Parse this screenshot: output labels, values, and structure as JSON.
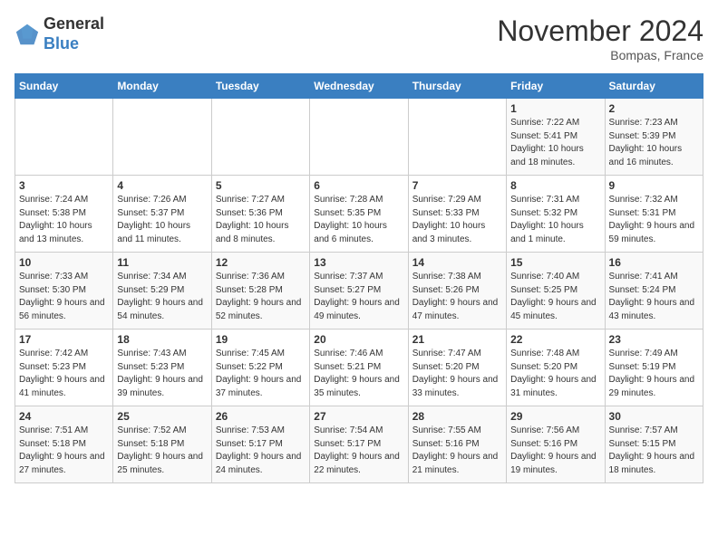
{
  "logo": {
    "general": "General",
    "blue": "Blue"
  },
  "title": "November 2024",
  "location": "Bompas, France",
  "days_of_week": [
    "Sunday",
    "Monday",
    "Tuesday",
    "Wednesday",
    "Thursday",
    "Friday",
    "Saturday"
  ],
  "weeks": [
    [
      {
        "day": "",
        "sunrise": "",
        "sunset": "",
        "daylight": ""
      },
      {
        "day": "",
        "sunrise": "",
        "sunset": "",
        "daylight": ""
      },
      {
        "day": "",
        "sunrise": "",
        "sunset": "",
        "daylight": ""
      },
      {
        "day": "",
        "sunrise": "",
        "sunset": "",
        "daylight": ""
      },
      {
        "day": "",
        "sunrise": "",
        "sunset": "",
        "daylight": ""
      },
      {
        "day": "1",
        "sunrise": "Sunrise: 7:22 AM",
        "sunset": "Sunset: 5:41 PM",
        "daylight": "Daylight: 10 hours and 18 minutes."
      },
      {
        "day": "2",
        "sunrise": "Sunrise: 7:23 AM",
        "sunset": "Sunset: 5:39 PM",
        "daylight": "Daylight: 10 hours and 16 minutes."
      }
    ],
    [
      {
        "day": "3",
        "sunrise": "Sunrise: 7:24 AM",
        "sunset": "Sunset: 5:38 PM",
        "daylight": "Daylight: 10 hours and 13 minutes."
      },
      {
        "day": "4",
        "sunrise": "Sunrise: 7:26 AM",
        "sunset": "Sunset: 5:37 PM",
        "daylight": "Daylight: 10 hours and 11 minutes."
      },
      {
        "day": "5",
        "sunrise": "Sunrise: 7:27 AM",
        "sunset": "Sunset: 5:36 PM",
        "daylight": "Daylight: 10 hours and 8 minutes."
      },
      {
        "day": "6",
        "sunrise": "Sunrise: 7:28 AM",
        "sunset": "Sunset: 5:35 PM",
        "daylight": "Daylight: 10 hours and 6 minutes."
      },
      {
        "day": "7",
        "sunrise": "Sunrise: 7:29 AM",
        "sunset": "Sunset: 5:33 PM",
        "daylight": "Daylight: 10 hours and 3 minutes."
      },
      {
        "day": "8",
        "sunrise": "Sunrise: 7:31 AM",
        "sunset": "Sunset: 5:32 PM",
        "daylight": "Daylight: 10 hours and 1 minute."
      },
      {
        "day": "9",
        "sunrise": "Sunrise: 7:32 AM",
        "sunset": "Sunset: 5:31 PM",
        "daylight": "Daylight: 9 hours and 59 minutes."
      }
    ],
    [
      {
        "day": "10",
        "sunrise": "Sunrise: 7:33 AM",
        "sunset": "Sunset: 5:30 PM",
        "daylight": "Daylight: 9 hours and 56 minutes."
      },
      {
        "day": "11",
        "sunrise": "Sunrise: 7:34 AM",
        "sunset": "Sunset: 5:29 PM",
        "daylight": "Daylight: 9 hours and 54 minutes."
      },
      {
        "day": "12",
        "sunrise": "Sunrise: 7:36 AM",
        "sunset": "Sunset: 5:28 PM",
        "daylight": "Daylight: 9 hours and 52 minutes."
      },
      {
        "day": "13",
        "sunrise": "Sunrise: 7:37 AM",
        "sunset": "Sunset: 5:27 PM",
        "daylight": "Daylight: 9 hours and 49 minutes."
      },
      {
        "day": "14",
        "sunrise": "Sunrise: 7:38 AM",
        "sunset": "Sunset: 5:26 PM",
        "daylight": "Daylight: 9 hours and 47 minutes."
      },
      {
        "day": "15",
        "sunrise": "Sunrise: 7:40 AM",
        "sunset": "Sunset: 5:25 PM",
        "daylight": "Daylight: 9 hours and 45 minutes."
      },
      {
        "day": "16",
        "sunrise": "Sunrise: 7:41 AM",
        "sunset": "Sunset: 5:24 PM",
        "daylight": "Daylight: 9 hours and 43 minutes."
      }
    ],
    [
      {
        "day": "17",
        "sunrise": "Sunrise: 7:42 AM",
        "sunset": "Sunset: 5:23 PM",
        "daylight": "Daylight: 9 hours and 41 minutes."
      },
      {
        "day": "18",
        "sunrise": "Sunrise: 7:43 AM",
        "sunset": "Sunset: 5:23 PM",
        "daylight": "Daylight: 9 hours and 39 minutes."
      },
      {
        "day": "19",
        "sunrise": "Sunrise: 7:45 AM",
        "sunset": "Sunset: 5:22 PM",
        "daylight": "Daylight: 9 hours and 37 minutes."
      },
      {
        "day": "20",
        "sunrise": "Sunrise: 7:46 AM",
        "sunset": "Sunset: 5:21 PM",
        "daylight": "Daylight: 9 hours and 35 minutes."
      },
      {
        "day": "21",
        "sunrise": "Sunrise: 7:47 AM",
        "sunset": "Sunset: 5:20 PM",
        "daylight": "Daylight: 9 hours and 33 minutes."
      },
      {
        "day": "22",
        "sunrise": "Sunrise: 7:48 AM",
        "sunset": "Sunset: 5:20 PM",
        "daylight": "Daylight: 9 hours and 31 minutes."
      },
      {
        "day": "23",
        "sunrise": "Sunrise: 7:49 AM",
        "sunset": "Sunset: 5:19 PM",
        "daylight": "Daylight: 9 hours and 29 minutes."
      }
    ],
    [
      {
        "day": "24",
        "sunrise": "Sunrise: 7:51 AM",
        "sunset": "Sunset: 5:18 PM",
        "daylight": "Daylight: 9 hours and 27 minutes."
      },
      {
        "day": "25",
        "sunrise": "Sunrise: 7:52 AM",
        "sunset": "Sunset: 5:18 PM",
        "daylight": "Daylight: 9 hours and 25 minutes."
      },
      {
        "day": "26",
        "sunrise": "Sunrise: 7:53 AM",
        "sunset": "Sunset: 5:17 PM",
        "daylight": "Daylight: 9 hours and 24 minutes."
      },
      {
        "day": "27",
        "sunrise": "Sunrise: 7:54 AM",
        "sunset": "Sunset: 5:17 PM",
        "daylight": "Daylight: 9 hours and 22 minutes."
      },
      {
        "day": "28",
        "sunrise": "Sunrise: 7:55 AM",
        "sunset": "Sunset: 5:16 PM",
        "daylight": "Daylight: 9 hours and 21 minutes."
      },
      {
        "day": "29",
        "sunrise": "Sunrise: 7:56 AM",
        "sunset": "Sunset: 5:16 PM",
        "daylight": "Daylight: 9 hours and 19 minutes."
      },
      {
        "day": "30",
        "sunrise": "Sunrise: 7:57 AM",
        "sunset": "Sunset: 5:15 PM",
        "daylight": "Daylight: 9 hours and 18 minutes."
      }
    ]
  ]
}
